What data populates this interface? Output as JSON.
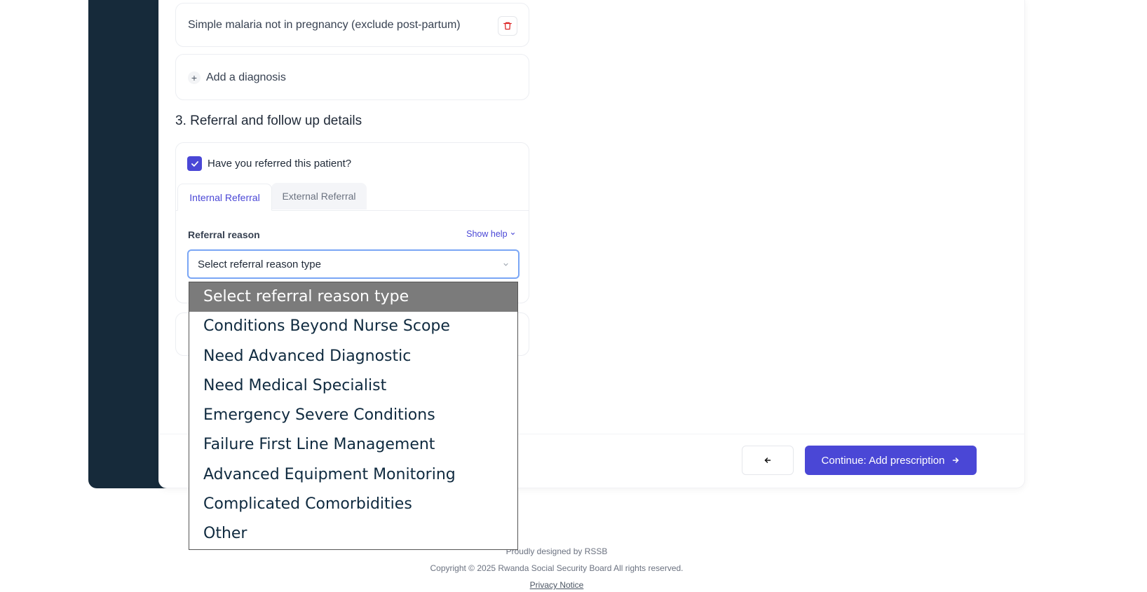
{
  "diagnoses": {
    "item": "Simple malaria not in pregnancy (exclude post-partum)",
    "add_label": "Add a diagnosis"
  },
  "referral_section": {
    "title": "3. Referral and follow up details",
    "checkbox_label": "Have you referred this patient?",
    "checked": true,
    "tabs": {
      "internal": "Internal Referral",
      "external": "External Referral"
    },
    "reason_label": "Referral reason",
    "show_help": "Show help",
    "select_value": "Select referral reason type"
  },
  "dropdown": {
    "options": [
      "Select referral reason type",
      "Conditions Beyond Nurse Scope",
      "Need Advanced Diagnostic",
      "Need Medical Specialist",
      "Emergency Severe Conditions",
      "Failure First Line Management",
      "Advanced Equipment Monitoring",
      "Complicated Comorbidities",
      "Other"
    ],
    "selected_index": 0
  },
  "actions": {
    "continue_label": "Continue: Add prescription"
  },
  "footer": {
    "designed_by": "Proudly designed by RSSB",
    "copyright": "Copyright © 2025 Rwanda Social Security Board All rights reserved.",
    "privacy": "Privacy Notice"
  },
  "colors": {
    "accent": "#4a47d6",
    "sidebar": "#162a3a",
    "delete": "#dc2626"
  },
  "icons": [
    "trash-icon",
    "plus-icon",
    "check-icon",
    "chevron-down-icon",
    "arrow-left-icon",
    "arrow-right-icon"
  ]
}
